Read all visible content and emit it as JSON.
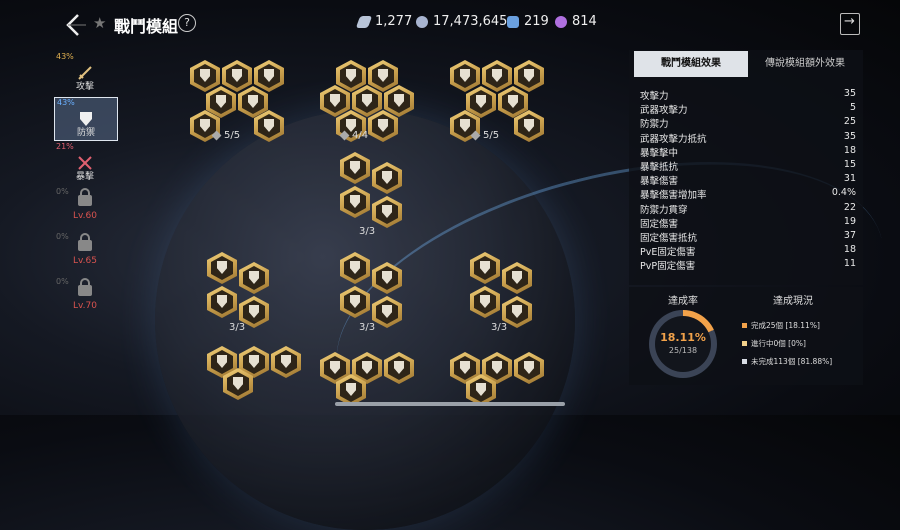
{
  "header": {
    "title": "戰鬥模組",
    "resources": [
      {
        "name": "crystal-icon",
        "value": "1,277",
        "color": "#b8c4d8"
      },
      {
        "name": "shield-coin-icon",
        "value": "17,473,645",
        "color": "#a8b4d0"
      },
      {
        "name": "blue-gem-icon",
        "value": "219",
        "color": "#6aa0e0"
      },
      {
        "name": "purple-gem-icon",
        "value": "814",
        "color": "#b070e0"
      }
    ]
  },
  "sidebar": [
    {
      "pct": "43%",
      "label": "攻擊",
      "pct_color": "#e0b050"
    },
    {
      "pct": "43%",
      "label": "防禦",
      "pct_color": "#6ab0ff"
    },
    {
      "pct": "21%",
      "label": "暴擊",
      "pct_color": "#e06070"
    },
    {
      "pct": "0%",
      "lv": "Lv.60"
    },
    {
      "pct": "0%",
      "lv": "Lv.65"
    },
    {
      "pct": "0%",
      "lv": "Lv.70"
    }
  ],
  "modules": [
    {
      "count": "5/5",
      "pinned": true
    },
    {
      "count": "4/4",
      "pinned": true
    },
    {
      "count": "5/5",
      "pinned": true
    },
    {
      "count": "3/3"
    },
    {
      "count": "3/3"
    },
    {
      "count": "3/3"
    },
    {
      "count": "3/3"
    }
  ],
  "panel": {
    "tab_active": "戰鬥模組效果",
    "tab_other": "傳說模組額外效果",
    "stats": [
      {
        "name": "攻擊力",
        "value": "35"
      },
      {
        "name": "武器攻擊力",
        "value": "5"
      },
      {
        "name": "防禦力",
        "value": "25"
      },
      {
        "name": "武器攻擊力抵抗",
        "value": "35"
      },
      {
        "name": "暴擊擊中",
        "value": "18"
      },
      {
        "name": "暴擊抵抗",
        "value": "15"
      },
      {
        "name": "暴擊傷害",
        "value": "31"
      },
      {
        "name": "暴擊傷害增加率",
        "value": "0.4%"
      },
      {
        "name": "防禦力貫穿",
        "value": "22"
      },
      {
        "name": "固定傷害",
        "value": "19"
      },
      {
        "name": "固定傷害抵抗",
        "value": "37"
      },
      {
        "name": "PvE固定傷害",
        "value": "18"
      },
      {
        "name": "PvP固定傷害",
        "value": "11"
      }
    ]
  },
  "achievement": {
    "rate_label": "達成率",
    "status_label": "達成現況",
    "percent": "18.11%",
    "fraction": "25/138",
    "progress": 0.1811,
    "legend": [
      {
        "text": "完成25個 [18.11%]",
        "color": "#f2a24a"
      },
      {
        "text": "進行中0個 [0%]",
        "color": "#f2d08a"
      },
      {
        "text": "未完成113個 [81.88%]",
        "color": "#d8dce4"
      }
    ]
  }
}
